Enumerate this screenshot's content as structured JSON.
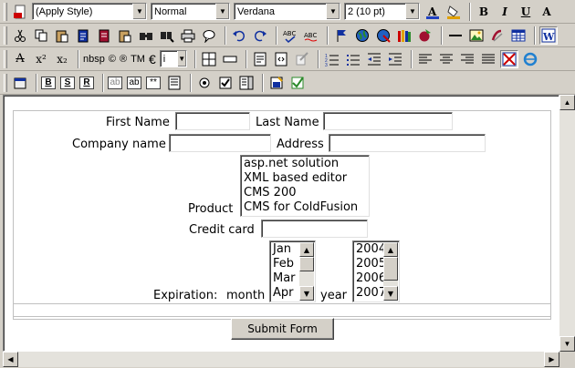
{
  "toolbar": {
    "style_combo": "(Apply Style)",
    "format_combo": "Normal",
    "font_combo": "Verdana",
    "size_combo": "2 (10 pt)",
    "bold": "B",
    "italic": "I",
    "underline": "U",
    "font_color": "A",
    "strike": "A",
    "superscript": "x²",
    "subscript": "x₂",
    "nbsp": "nbsp",
    "copyright": "©",
    "registered": "®",
    "trademark": "TM",
    "euro": "€",
    "symbol_combo": "i",
    "label_b": "B",
    "label_s": "S",
    "label_r": "R",
    "field_ab1": "ab",
    "field_ab2": "ab",
    "field_pw": "**"
  },
  "form": {
    "first_name_label": "First Name",
    "last_name_label": "Last Name",
    "company_label": "Company name",
    "address_label": "Address",
    "product_label": "Product",
    "products": [
      "asp.net solution",
      "XML based editor",
      "CMS 200",
      "CMS for ColdFusion"
    ],
    "credit_card_label": "Credit card",
    "expiration_label": "Expiration:",
    "month_label": "month",
    "months": [
      "Jan",
      "Feb",
      "Mar",
      "Apr"
    ],
    "year_label": "year",
    "years": [
      "2004",
      "2005",
      "2006",
      "2007"
    ],
    "submit_label": "Submit Form"
  }
}
